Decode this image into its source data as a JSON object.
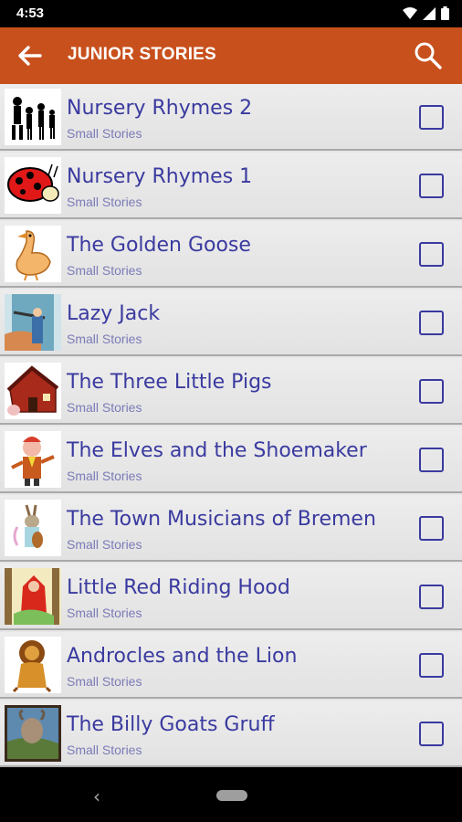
{
  "status": {
    "time": "4:53"
  },
  "appbar": {
    "title": "JUNIOR STORIES",
    "bg": "#c8501c"
  },
  "colors": {
    "title_text": "#3a3aa0",
    "subtitle_text": "#7b7bb8"
  },
  "stories": [
    {
      "title": "Nursery Rhymes 2",
      "subtitle": "Small Stories",
      "icon": "silhouette-family-icon",
      "checked": false
    },
    {
      "title": "Nursery Rhymes 1",
      "subtitle": "Small Stories",
      "icon": "ladybug-icon",
      "checked": false
    },
    {
      "title": "The Golden Goose",
      "subtitle": "Small Stories",
      "icon": "goose-icon",
      "checked": false
    },
    {
      "title": "Lazy Jack",
      "subtitle": "Small Stories",
      "icon": "lazy-jack-icon",
      "checked": false
    },
    {
      "title": "The Three Little Pigs",
      "subtitle": "Small Stories",
      "icon": "red-house-icon",
      "checked": false
    },
    {
      "title": "The Elves and the Shoemaker",
      "subtitle": "Small Stories",
      "icon": "elf-icon",
      "checked": false
    },
    {
      "title": "The Town Musicians of Bremen",
      "subtitle": "Small Stories",
      "icon": "donkey-musician-icon",
      "checked": false
    },
    {
      "title": "Little Red Riding Hood",
      "subtitle": "Small Stories",
      "icon": "red-riding-hood-icon",
      "checked": false
    },
    {
      "title": "Androcles and the Lion",
      "subtitle": "Small Stories",
      "icon": "lion-icon",
      "checked": false
    },
    {
      "title": "The Billy Goats Gruff",
      "subtitle": "Small Stories",
      "icon": "billy-goat-icon",
      "checked": false
    }
  ]
}
